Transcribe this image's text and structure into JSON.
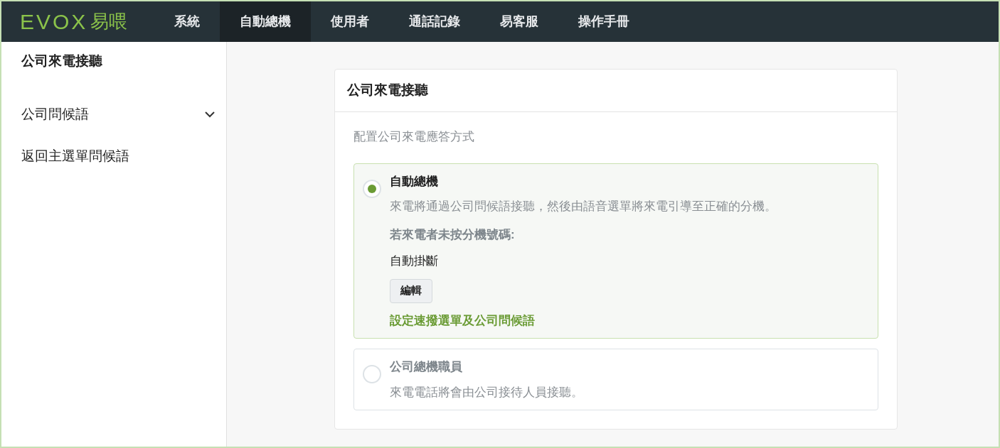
{
  "navbar": {
    "logo": {
      "wordmark": "EVOX",
      "name": "易喂"
    },
    "items": [
      {
        "label": "系統",
        "selected": false
      },
      {
        "label": "自動總機",
        "selected": true
      },
      {
        "label": "使用者",
        "selected": false
      },
      {
        "label": "通話記錄",
        "selected": false
      },
      {
        "label": "易客服",
        "selected": false
      },
      {
        "label": "操作手冊",
        "selected": false
      }
    ]
  },
  "sidebar": {
    "items": [
      {
        "label": "公司來電接聽",
        "selected": true,
        "expandable": false
      },
      {
        "label": "公司問候語",
        "selected": false,
        "expandable": true
      },
      {
        "label": "返回主選單問候語",
        "selected": false,
        "expandable": false
      }
    ]
  },
  "card": {
    "title": "公司來電接聽",
    "description": "配置公司來電應答方式",
    "options": [
      {
        "title": "自動總機",
        "selected": true,
        "description": "來電將通過公司問候語接聽，然後由語音選單將來電引導至正確的分機。",
        "fallback_label": "若來電者未按分機號碼:",
        "fallback_value": "自動掛斷",
        "edit_button": "編輯",
        "link": "設定速撥選單及公司問候語"
      },
      {
        "title": "公司總機職員",
        "selected": false,
        "description": "來電電話將會由公司接待人員接聽。"
      }
    ]
  }
}
